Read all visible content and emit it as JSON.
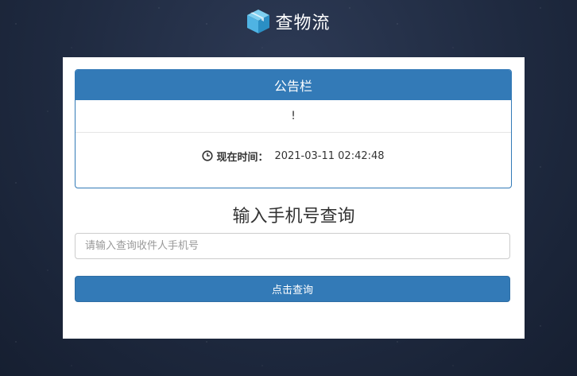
{
  "header": {
    "brand": "查物流",
    "logo_icon": "package-box-icon"
  },
  "notice_panel": {
    "title": "公告栏",
    "notice_text": "!",
    "time_icon": "clock-icon",
    "time_label": "现在时间：",
    "time_value": "2021-03-11 02:42:48"
  },
  "query": {
    "title": "输入手机号查询",
    "input_placeholder": "请输入查询收件人手机号",
    "input_value": "",
    "button_label": "点击查询"
  },
  "colors": {
    "primary": "#337ab7",
    "logo_blue": "#4fb3e3"
  }
}
